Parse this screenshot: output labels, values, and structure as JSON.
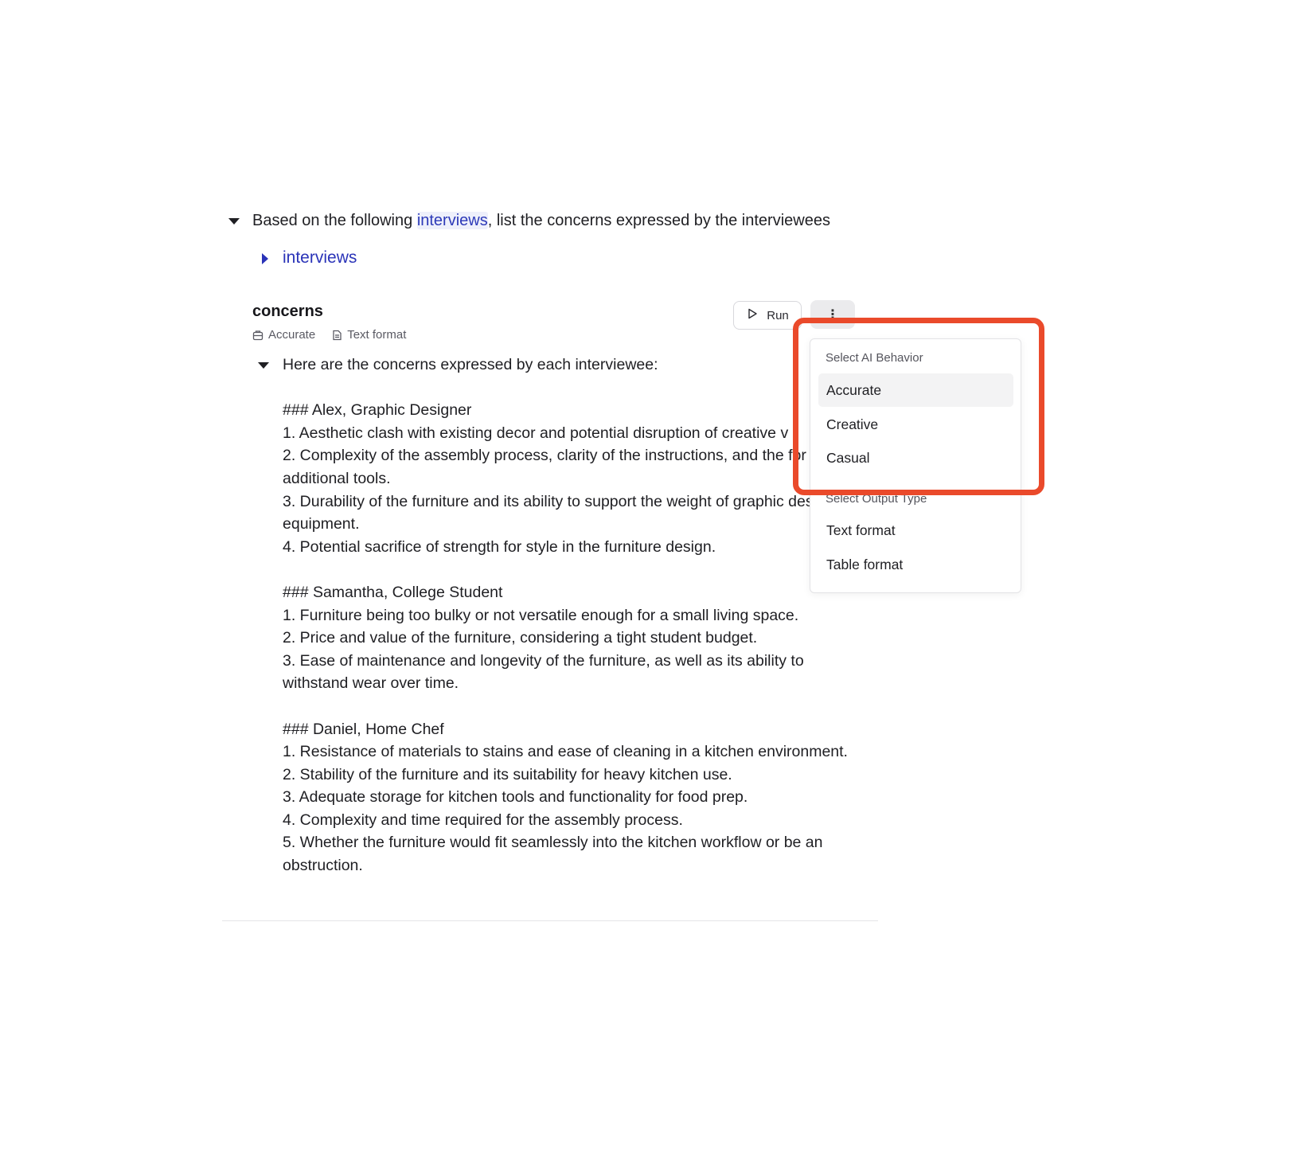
{
  "prompt": {
    "prefix": "Based on the following ",
    "mention": "interviews",
    "suffix": ", list the concerns expressed by the interviewees"
  },
  "reference": {
    "label": "interviews"
  },
  "block": {
    "title": "concerns",
    "behavior_tag": "Accurate",
    "format_tag": "Text format",
    "run_label": "Run",
    "more_glyph": "⋮"
  },
  "output": {
    "intro": "Here are the concerns expressed by each interviewee:",
    "sections": [
      {
        "heading": "### Alex, Graphic Designer",
        "items": [
          "1. Aesthetic clash with existing decor and potential disruption of creative v",
          "2. Complexity of the assembly process, clarity of the instructions, and the for additional tools.",
          "3. Durability of the furniture and its ability to support the weight of graphic design equipment.",
          "4. Potential sacrifice of strength for style in the furniture design."
        ]
      },
      {
        "heading": "### Samantha, College Student",
        "items": [
          "1. Furniture being too bulky or not versatile enough for a small living space.",
          "2. Price and value of the furniture, considering a tight student budget.",
          "3. Ease of maintenance and longevity of the furniture, as well as its ability to withstand wear over time."
        ]
      },
      {
        "heading": "### Daniel, Home Chef",
        "items": [
          "1. Resistance of materials to stains and ease of cleaning in a kitchen environment.",
          "2. Stability of the furniture and its suitability for heavy kitchen use.",
          "3. Adequate storage for kitchen tools and functionality for food prep.",
          "4. Complexity and time required for the assembly process.",
          "5. Whether the furniture would fit seamlessly into the kitchen workflow or be an obstruction."
        ]
      }
    ]
  },
  "menu": {
    "behavior_heading": "Select AI Behavior",
    "behaviors": [
      "Accurate",
      "Creative",
      "Casual"
    ],
    "selected_behavior": "Accurate",
    "output_heading": "Select Output Type",
    "output_types": [
      "Text format",
      "Table format"
    ]
  },
  "colors": {
    "accent_link": "#2d3ab8",
    "highlight_border": "#ea4a2b"
  }
}
